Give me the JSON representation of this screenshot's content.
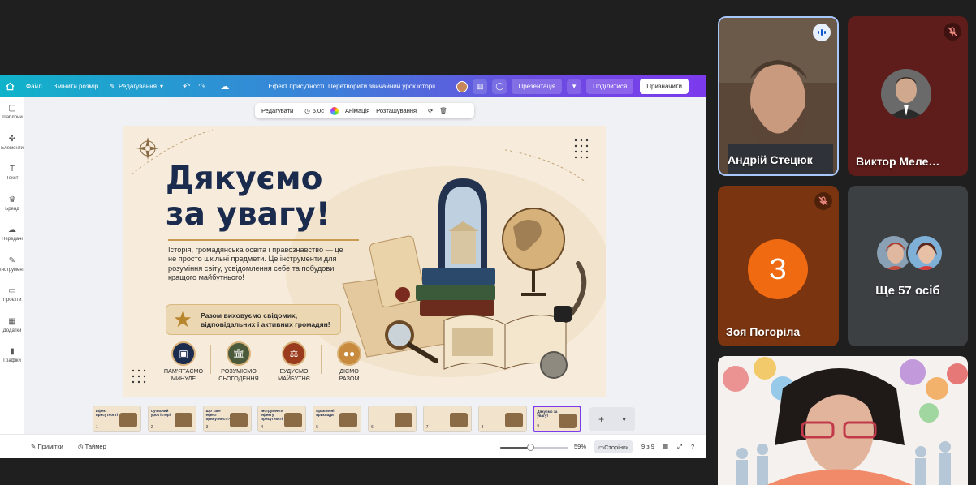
{
  "canva": {
    "menu_file": "Файл",
    "menu_resize": "Змінити розмір",
    "menu_edit": "Редагування",
    "doc_title": "Ефект присутності. Перетворити звичайний урок історії ...",
    "btn_present": "Презентація",
    "btn_share": "Поділитися",
    "btn_assign": "Призначити",
    "sidebar": [
      {
        "label": "Шаблони",
        "icon": "templates-icon"
      },
      {
        "label": "Елементи",
        "icon": "elements-icon"
      },
      {
        "label": "Текст",
        "icon": "text-icon"
      },
      {
        "label": "Бренд",
        "icon": "brand-icon"
      },
      {
        "label": "Передані",
        "icon": "uploads-icon"
      },
      {
        "label": "Інструменти",
        "icon": "tools-icon"
      },
      {
        "label": "Проєкти",
        "icon": "projects-icon"
      },
      {
        "label": "Додатки",
        "icon": "apps-icon"
      },
      {
        "label": "Графіки",
        "icon": "charts-icon"
      }
    ],
    "context_toolbar": {
      "edit": "Редагувати",
      "duration": "5.0с",
      "animation": "Анімація",
      "position": "Розташування"
    },
    "slide": {
      "title_line1": "Дякуємо",
      "title_line2": "за увагу!",
      "body": "Історія, громадянська освіта і правознавство — це не просто шкільні предмети. Це інструменти для розуміння світу, усвідомлення себе та побудови кращого майбутнього!",
      "callout": "Разом виховуємо свідомих, відповідальних і активних громадян!",
      "icons": [
        {
          "caption": "ПАМ'ЯТАЄМО\nМИНУЛЕ",
          "color": "#1b2b4e",
          "icon": "picture-icon"
        },
        {
          "caption": "РОЗУМІЄМО\nСЬОГОДЕННЯ",
          "color": "#4a5a3a",
          "icon": "museum-icon"
        },
        {
          "caption": "БУДУЄМО\nМАЙБУТНЄ",
          "color": "#9a3b1e",
          "icon": "scales-icon"
        },
        {
          "caption": "ДІЄМО\nРАЗОМ",
          "color": "#c88a3c",
          "icon": "people-icon"
        }
      ]
    },
    "thumbnails": [
      {
        "title": "Ефект присутності",
        "num": "1"
      },
      {
        "title": "Сучасний урок історії",
        "num": "2"
      },
      {
        "title": "Що таке ефект присутності?",
        "num": "3"
      },
      {
        "title": "Інструменти ефекту присутності",
        "num": "4"
      },
      {
        "title": "Практичні приклади",
        "num": "5"
      },
      {
        "title": "",
        "num": "6"
      },
      {
        "title": "",
        "num": "7"
      },
      {
        "title": "",
        "num": "8"
      },
      {
        "title": "Дякуємо за увагу!",
        "num": "9"
      }
    ],
    "bottom": {
      "notes": "Примітки",
      "timer": "Таймер",
      "zoom": "59%",
      "zoom_fraction": 0.59,
      "pages": "Сторінки",
      "page_count": "9 з 9"
    }
  },
  "participants": [
    {
      "name": "Андрій Стецюк",
      "speaking": true
    },
    {
      "name": "Виктор Меле…",
      "muted": true
    },
    {
      "name": "Зоя Погоріла",
      "initial": "З",
      "muted": true
    },
    {
      "name": "Ще 57 осіб"
    }
  ],
  "colors": {
    "accent": "#7c3aed",
    "avatar_orange": "#f06a12",
    "slide_bg": "#f7ecdc",
    "title_navy": "#1b2b4e"
  }
}
